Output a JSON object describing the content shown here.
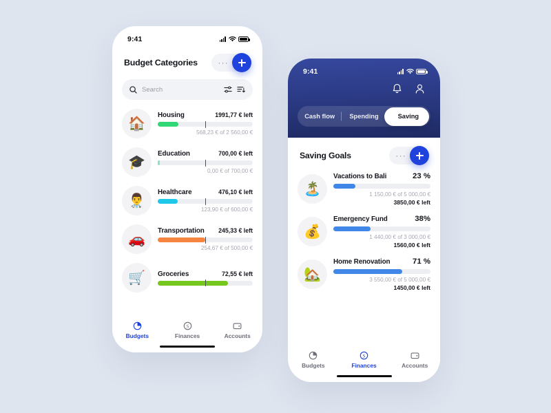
{
  "background_color": "#dfe5ef",
  "accent_blue": "#1f42dd",
  "phone_left": {
    "status_bar": {
      "time": "9:41",
      "signal_icon": "cellular-signal-icon",
      "wifi_icon": "wifi-icon",
      "battery_icon": "battery-icon"
    },
    "header": {
      "title": "Budget Categories",
      "more_label": "···",
      "add_label": "+"
    },
    "search": {
      "placeholder": "Search",
      "search_icon": "search-icon",
      "filter_icon": "filter-sliders-icon",
      "sort_icon": "sort-descending-icon"
    },
    "categories": [
      {
        "icon": "🏠",
        "icon_name": "house-emoji",
        "name": "Housing",
        "left": "1991,77 € left",
        "sub": "568,23 € of 2 560,00 €",
        "percent": 22,
        "tick": 50,
        "color": "#32d776"
      },
      {
        "icon": "🎓",
        "icon_name": "graduation-cap-emoji",
        "name": "Education",
        "left": "700,00 € left",
        "sub": "0,00 € of 700,00 €",
        "percent": 2,
        "tick": 50,
        "color": "#8fe3c4"
      },
      {
        "icon": "👨‍⚕️",
        "icon_name": "doctor-emoji",
        "name": "Healthcare",
        "left": "476,10 € left",
        "sub": "123,90 € of 600,00 €",
        "percent": 21,
        "tick": 50,
        "color": "#1ec8e8"
      },
      {
        "icon": "🚗",
        "icon_name": "car-emoji",
        "name": "Transportation",
        "left": "245,33 € left",
        "sub": "254,67 € of 500,00 €",
        "percent": 50,
        "tick": 50,
        "color": "#f5853f"
      },
      {
        "icon": "🛒",
        "icon_name": "shopping-cart-emoji",
        "name": "Groceries",
        "left": "72,55 € left",
        "sub": "",
        "percent": 74,
        "tick": 50,
        "color": "#76c71e"
      }
    ],
    "tabs": [
      {
        "label": "Budgets",
        "icon_name": "pie-chart-icon",
        "active": true
      },
      {
        "label": "Finances",
        "icon_name": "dollar-circle-icon",
        "active": false
      },
      {
        "label": "Accounts",
        "icon_name": "wallet-icon",
        "active": false
      }
    ]
  },
  "phone_right": {
    "status_bar": {
      "time": "9:41",
      "signal_icon": "cellular-signal-icon",
      "wifi_icon": "wifi-icon",
      "battery_icon": "battery-icon"
    },
    "header_icons": {
      "bell": "bell-icon",
      "profile": "user-avatar-icon"
    },
    "segments": [
      {
        "label": "Cash flow",
        "active": false
      },
      {
        "label": "Spending",
        "active": false
      },
      {
        "label": "Saving",
        "active": true
      }
    ],
    "header": {
      "title": "Saving Goals",
      "more_label": "···",
      "add_label": "+"
    },
    "goals": [
      {
        "icon": "🏝️",
        "icon_name": "island-emoji",
        "name": "Vacations to Bali",
        "percent_label": "23 %",
        "percent": 23,
        "sub": "1 150,00 € of 5 000,00 €",
        "left": "3850,00 € left"
      },
      {
        "icon": "💰",
        "icon_name": "money-bag-emoji",
        "name": "Emergency Fund",
        "percent_label": "38%",
        "percent": 38,
        "sub": "1 440,00 € of 3 000,00 €",
        "left": "1560,00 € left"
      },
      {
        "icon": "🏡",
        "icon_name": "house-with-garden-emoji",
        "name": "Home Renovation",
        "percent_label": "71 %",
        "percent": 71,
        "sub": "3 550,00 € of 5 000,00 €",
        "left": "1450,00 € left"
      }
    ],
    "tabs": [
      {
        "label": "Budgets",
        "icon_name": "pie-chart-icon",
        "active": false
      },
      {
        "label": "Finances",
        "icon_name": "dollar-circle-icon",
        "active": true
      },
      {
        "label": "Accounts",
        "icon_name": "wallet-icon",
        "active": false
      }
    ]
  }
}
